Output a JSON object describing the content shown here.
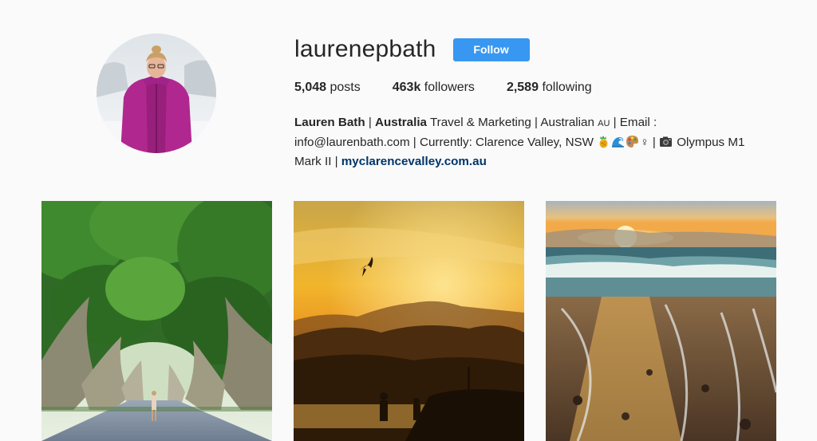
{
  "profile": {
    "username": "laurenepbath",
    "follow_label": "Follow"
  },
  "stats": {
    "posts_count": "5,048",
    "posts_label": "posts",
    "followers_count": "463k",
    "followers_label": "followers",
    "following_count": "2,589",
    "following_label": "following"
  },
  "bio": {
    "name": "Lauren Bath",
    "sep": " | ",
    "location_bold": "Australia",
    "text1": " Travel & Marketing | Australian ",
    "au_flag": "AU",
    "text2": " | Email : info@laurenbath.com | Currently: Clarence Valley, NSW ",
    "gender": "♀",
    "text3": " | ",
    "text4": " Olympus M1 Mark II | ",
    "link": "myclarencevalley.com.au"
  },
  "icons": {
    "emoji_1": "pineapple-icon",
    "emoji_2": "wave-icon",
    "emoji_3": "palette-icon",
    "camera": "camera-icon"
  },
  "colors": {
    "follow_button": "#3897f0",
    "link": "#003569",
    "background": "#fafafa"
  }
}
